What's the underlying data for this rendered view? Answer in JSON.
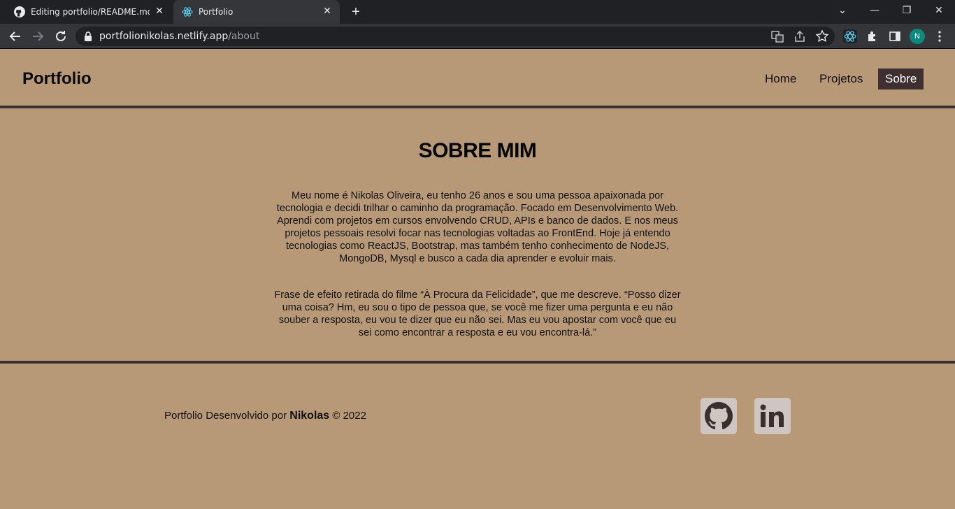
{
  "browser": {
    "tabs": [
      {
        "title": "Editing portfolio/README.md at",
        "icon": "github-icon",
        "active": false
      },
      {
        "title": "Portfolio",
        "icon": "react-icon",
        "active": true
      }
    ],
    "url_host": "portfolionikolas.netlify.app",
    "url_path": "/about",
    "profile_initial": "N"
  },
  "header": {
    "brand": "Portfolio",
    "nav": [
      {
        "label": "Home"
      },
      {
        "label": "Projetos"
      },
      {
        "label": "Sobre",
        "active": true
      }
    ]
  },
  "main": {
    "title": "SOBRE MIM",
    "paragraph1": "Meu nome é Nikolas Oliveira, eu tenho 26 anos e sou uma pessoa apaixonada por tecnologia e decidi trilhar o caminho da programação. Focado em Desenvolvimento Web. Aprendi com projetos em cursos envolvendo CRUD, APIs e banco de dados. E nos meus projetos pessoais resolvi focar nas tecnologias voltadas ao FrontEnd. Hoje já entendo tecnologias como ReactJS, Bootstrap, mas também tenho conhecimento de NodeJS, MongoDB, Mysql e busco a cada dia aprender e evoluir mais.",
    "paragraph2": "Frase de efeito retirada do filme “À Procura da Felicidade”, que me descreve. “Posso dizer uma coisa? Hm, eu sou o tipo de pessoa que, se você me fizer uma pergunta e eu não souber a resposta, eu vou te dizer que eu não sei. Mas eu vou apostar com você que eu sei como encontrar a resposta e eu vou encontra-lá.”"
  },
  "footer": {
    "credit_prefix": "Portfolio Desenvolvido por",
    "credit_name": "Nikolas",
    "credit_suffix": "© 2022",
    "social": [
      {
        "icon": "github-icon"
      },
      {
        "icon": "linkedin-icon"
      }
    ]
  },
  "colors": {
    "background": "#b89977",
    "accent": "#3e3030"
  }
}
